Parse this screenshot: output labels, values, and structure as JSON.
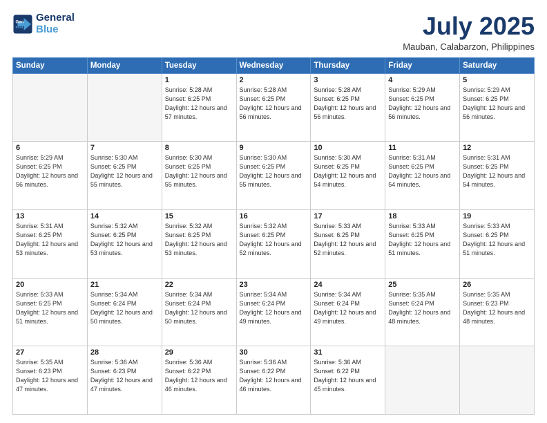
{
  "logo": {
    "line1": "General",
    "line2": "Blue"
  },
  "header": {
    "month_year": "July 2025",
    "location": "Mauban, Calabarzon, Philippines"
  },
  "days_of_week": [
    "Sunday",
    "Monday",
    "Tuesday",
    "Wednesday",
    "Thursday",
    "Friday",
    "Saturday"
  ],
  "weeks": [
    [
      {
        "day": "",
        "sunrise": "",
        "sunset": "",
        "daylight": "",
        "empty": true
      },
      {
        "day": "",
        "sunrise": "",
        "sunset": "",
        "daylight": "",
        "empty": true
      },
      {
        "day": "1",
        "sunrise": "Sunrise: 5:28 AM",
        "sunset": "Sunset: 6:25 PM",
        "daylight": "Daylight: 12 hours and 57 minutes.",
        "empty": false
      },
      {
        "day": "2",
        "sunrise": "Sunrise: 5:28 AM",
        "sunset": "Sunset: 6:25 PM",
        "daylight": "Daylight: 12 hours and 56 minutes.",
        "empty": false
      },
      {
        "day": "3",
        "sunrise": "Sunrise: 5:28 AM",
        "sunset": "Sunset: 6:25 PM",
        "daylight": "Daylight: 12 hours and 56 minutes.",
        "empty": false
      },
      {
        "day": "4",
        "sunrise": "Sunrise: 5:29 AM",
        "sunset": "Sunset: 6:25 PM",
        "daylight": "Daylight: 12 hours and 56 minutes.",
        "empty": false
      },
      {
        "day": "5",
        "sunrise": "Sunrise: 5:29 AM",
        "sunset": "Sunset: 6:25 PM",
        "daylight": "Daylight: 12 hours and 56 minutes.",
        "empty": false
      }
    ],
    [
      {
        "day": "6",
        "sunrise": "Sunrise: 5:29 AM",
        "sunset": "Sunset: 6:25 PM",
        "daylight": "Daylight: 12 hours and 56 minutes.",
        "empty": false
      },
      {
        "day": "7",
        "sunrise": "Sunrise: 5:30 AM",
        "sunset": "Sunset: 6:25 PM",
        "daylight": "Daylight: 12 hours and 55 minutes.",
        "empty": false
      },
      {
        "day": "8",
        "sunrise": "Sunrise: 5:30 AM",
        "sunset": "Sunset: 6:25 PM",
        "daylight": "Daylight: 12 hours and 55 minutes.",
        "empty": false
      },
      {
        "day": "9",
        "sunrise": "Sunrise: 5:30 AM",
        "sunset": "Sunset: 6:25 PM",
        "daylight": "Daylight: 12 hours and 55 minutes.",
        "empty": false
      },
      {
        "day": "10",
        "sunrise": "Sunrise: 5:30 AM",
        "sunset": "Sunset: 6:25 PM",
        "daylight": "Daylight: 12 hours and 54 minutes.",
        "empty": false
      },
      {
        "day": "11",
        "sunrise": "Sunrise: 5:31 AM",
        "sunset": "Sunset: 6:25 PM",
        "daylight": "Daylight: 12 hours and 54 minutes.",
        "empty": false
      },
      {
        "day": "12",
        "sunrise": "Sunrise: 5:31 AM",
        "sunset": "Sunset: 6:25 PM",
        "daylight": "Daylight: 12 hours and 54 minutes.",
        "empty": false
      }
    ],
    [
      {
        "day": "13",
        "sunrise": "Sunrise: 5:31 AM",
        "sunset": "Sunset: 6:25 PM",
        "daylight": "Daylight: 12 hours and 53 minutes.",
        "empty": false
      },
      {
        "day": "14",
        "sunrise": "Sunrise: 5:32 AM",
        "sunset": "Sunset: 6:25 PM",
        "daylight": "Daylight: 12 hours and 53 minutes.",
        "empty": false
      },
      {
        "day": "15",
        "sunrise": "Sunrise: 5:32 AM",
        "sunset": "Sunset: 6:25 PM",
        "daylight": "Daylight: 12 hours and 53 minutes.",
        "empty": false
      },
      {
        "day": "16",
        "sunrise": "Sunrise: 5:32 AM",
        "sunset": "Sunset: 6:25 PM",
        "daylight": "Daylight: 12 hours and 52 minutes.",
        "empty": false
      },
      {
        "day": "17",
        "sunrise": "Sunrise: 5:33 AM",
        "sunset": "Sunset: 6:25 PM",
        "daylight": "Daylight: 12 hours and 52 minutes.",
        "empty": false
      },
      {
        "day": "18",
        "sunrise": "Sunrise: 5:33 AM",
        "sunset": "Sunset: 6:25 PM",
        "daylight": "Daylight: 12 hours and 51 minutes.",
        "empty": false
      },
      {
        "day": "19",
        "sunrise": "Sunrise: 5:33 AM",
        "sunset": "Sunset: 6:25 PM",
        "daylight": "Daylight: 12 hours and 51 minutes.",
        "empty": false
      }
    ],
    [
      {
        "day": "20",
        "sunrise": "Sunrise: 5:33 AM",
        "sunset": "Sunset: 6:25 PM",
        "daylight": "Daylight: 12 hours and 51 minutes.",
        "empty": false
      },
      {
        "day": "21",
        "sunrise": "Sunrise: 5:34 AM",
        "sunset": "Sunset: 6:24 PM",
        "daylight": "Daylight: 12 hours and 50 minutes.",
        "empty": false
      },
      {
        "day": "22",
        "sunrise": "Sunrise: 5:34 AM",
        "sunset": "Sunset: 6:24 PM",
        "daylight": "Daylight: 12 hours and 50 minutes.",
        "empty": false
      },
      {
        "day": "23",
        "sunrise": "Sunrise: 5:34 AM",
        "sunset": "Sunset: 6:24 PM",
        "daylight": "Daylight: 12 hours and 49 minutes.",
        "empty": false
      },
      {
        "day": "24",
        "sunrise": "Sunrise: 5:34 AM",
        "sunset": "Sunset: 6:24 PM",
        "daylight": "Daylight: 12 hours and 49 minutes.",
        "empty": false
      },
      {
        "day": "25",
        "sunrise": "Sunrise: 5:35 AM",
        "sunset": "Sunset: 6:24 PM",
        "daylight": "Daylight: 12 hours and 48 minutes.",
        "empty": false
      },
      {
        "day": "26",
        "sunrise": "Sunrise: 5:35 AM",
        "sunset": "Sunset: 6:23 PM",
        "daylight": "Daylight: 12 hours and 48 minutes.",
        "empty": false
      }
    ],
    [
      {
        "day": "27",
        "sunrise": "Sunrise: 5:35 AM",
        "sunset": "Sunset: 6:23 PM",
        "daylight": "Daylight: 12 hours and 47 minutes.",
        "empty": false
      },
      {
        "day": "28",
        "sunrise": "Sunrise: 5:36 AM",
        "sunset": "Sunset: 6:23 PM",
        "daylight": "Daylight: 12 hours and 47 minutes.",
        "empty": false
      },
      {
        "day": "29",
        "sunrise": "Sunrise: 5:36 AM",
        "sunset": "Sunset: 6:22 PM",
        "daylight": "Daylight: 12 hours and 46 minutes.",
        "empty": false
      },
      {
        "day": "30",
        "sunrise": "Sunrise: 5:36 AM",
        "sunset": "Sunset: 6:22 PM",
        "daylight": "Daylight: 12 hours and 46 minutes.",
        "empty": false
      },
      {
        "day": "31",
        "sunrise": "Sunrise: 5:36 AM",
        "sunset": "Sunset: 6:22 PM",
        "daylight": "Daylight: 12 hours and 45 minutes.",
        "empty": false
      },
      {
        "day": "",
        "sunrise": "",
        "sunset": "",
        "daylight": "",
        "empty": true
      },
      {
        "day": "",
        "sunrise": "",
        "sunset": "",
        "daylight": "",
        "empty": true
      }
    ]
  ]
}
